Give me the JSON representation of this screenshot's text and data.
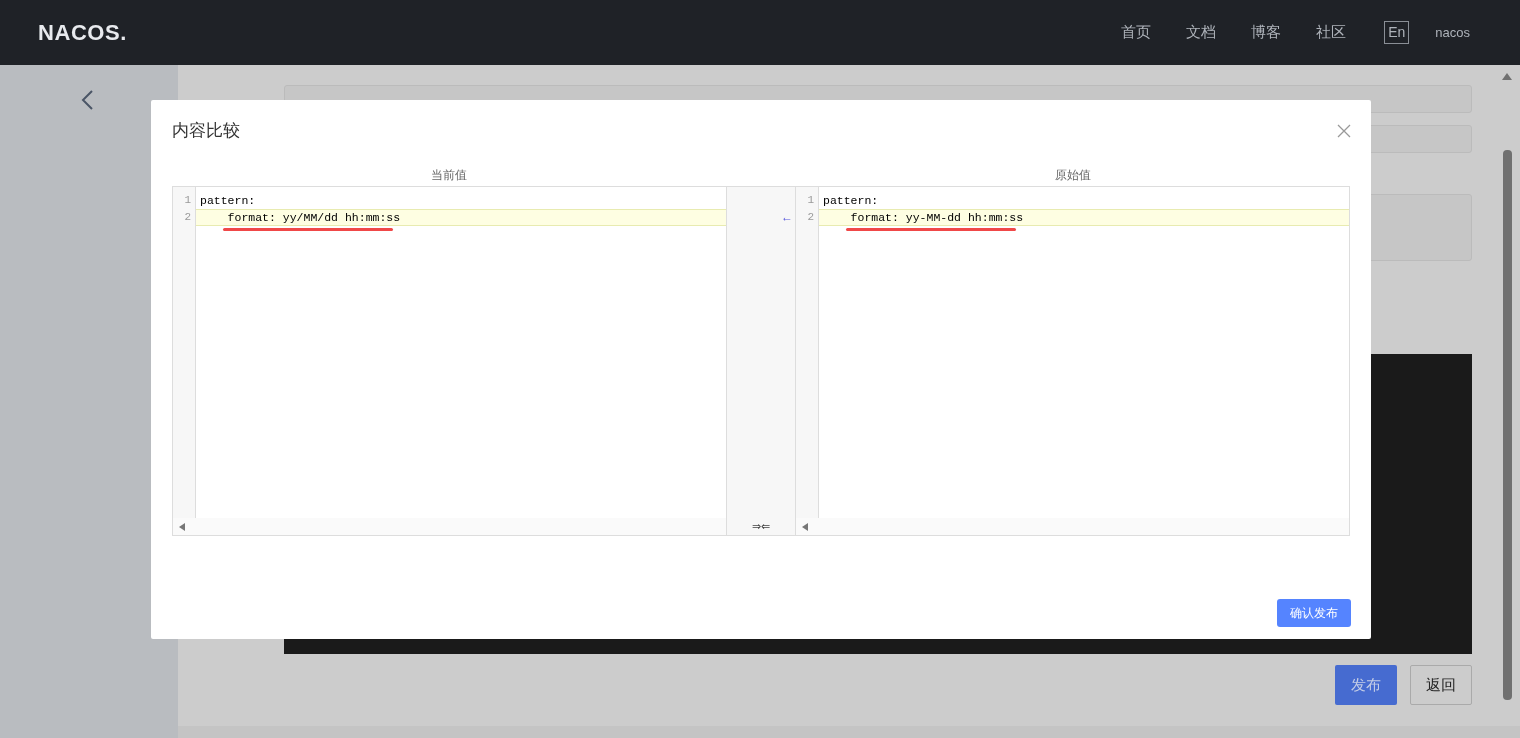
{
  "header": {
    "logo": "NACOS.",
    "nav": [
      {
        "label": "首页"
      },
      {
        "label": "文档"
      },
      {
        "label": "博客"
      },
      {
        "label": "社区"
      }
    ],
    "language": "En",
    "user": "nacos"
  },
  "form": {
    "buttons": [
      {
        "label": "发布",
        "kind": "primary"
      },
      {
        "label": "返回",
        "kind": "normal"
      }
    ]
  },
  "dialog": {
    "title": "内容比较",
    "left": {
      "heading": "当前值",
      "lines": [
        {
          "number": "1",
          "text": "pattern:",
          "changed": false,
          "annotated": false
        },
        {
          "number": "2",
          "text": "    format: yy/MM/dd hh:mm:ss",
          "changed": true,
          "annotated": true
        }
      ]
    },
    "middle": {
      "arrow": "←",
      "merge": "⇒⇐"
    },
    "right": {
      "heading": "原始值",
      "lines": [
        {
          "number": "1",
          "text": "pattern:",
          "changed": false,
          "annotated": false
        },
        {
          "number": "2",
          "text": "    format: yy-MM-dd hh:mm:ss",
          "changed": true,
          "annotated": true
        }
      ]
    },
    "confirm_button": "确认发布"
  }
}
